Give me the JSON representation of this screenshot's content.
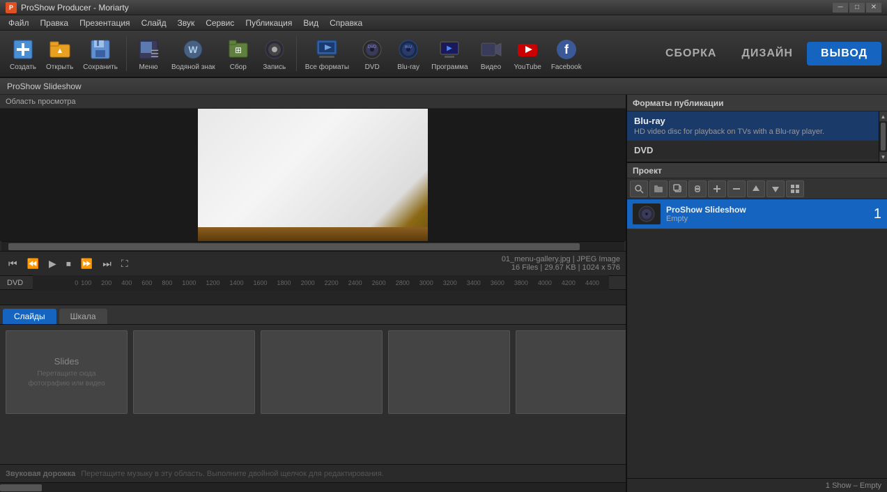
{
  "titlebar": {
    "icon_label": "P",
    "title": "ProShow Producer - Moriarty",
    "win_min": "─",
    "win_max": "□",
    "win_close": "✕"
  },
  "menubar": {
    "items": [
      "Файл",
      "Правка",
      "Презентация",
      "Слайд",
      "Звук",
      "Сервис",
      "Публикация",
      "Вид",
      "Справка"
    ]
  },
  "toolbar": {
    "buttons": [
      {
        "id": "create",
        "icon": "➕",
        "label": "Создать"
      },
      {
        "id": "open",
        "icon": "📂",
        "label": "Открыть"
      },
      {
        "id": "save",
        "icon": "💾",
        "label": "Сохранить"
      },
      {
        "id": "menu",
        "icon": "☰",
        "label": "Меню"
      },
      {
        "id": "watermark",
        "icon": "🔵",
        "label": "Водяной знак"
      },
      {
        "id": "collect",
        "icon": "📦",
        "label": "Сбор"
      },
      {
        "id": "record",
        "icon": "💿",
        "label": "Запись"
      },
      {
        "id": "allformats",
        "icon": "🎬",
        "label": "Все форматы"
      },
      {
        "id": "dvd",
        "icon": "💿",
        "label": "DVD"
      },
      {
        "id": "bluray",
        "icon": "💿",
        "label": "Blu-ray"
      },
      {
        "id": "program",
        "icon": "🖥",
        "label": "Программа"
      },
      {
        "id": "video",
        "icon": "🎥",
        "label": "Видео"
      },
      {
        "id": "youtube",
        "icon": "▶",
        "label": "YouTube"
      },
      {
        "id": "facebook",
        "icon": "👤",
        "label": "Facebook"
      }
    ],
    "mode_assembly": "СБОРКА",
    "mode_design": "ДИЗАЙН",
    "mode_output": "ВЫВОД"
  },
  "breadcrumb": {
    "text": "ProShow Slideshow"
  },
  "preview": {
    "label": "Область просмотра"
  },
  "controls": {
    "file_info_line1": "01_menu-gallery.jpg  |  JPEG Image",
    "file_info_line2": "16 Files  |  29.67 KB  |  1024 x 576"
  },
  "timeline": {
    "format_label": "DVD",
    "ruler_marks": [
      "0",
      "100",
      "200",
      "400",
      "600",
      "800",
      "1000",
      "1200",
      "1400",
      "1600",
      "1800",
      "2000",
      "2200",
      "2400",
      "2600",
      "2800",
      "3000",
      "3200",
      "3400",
      "3600",
      "3800",
      "4000",
      "4200",
      "4400"
    ],
    "footer_text": "1 Show – Empty"
  },
  "tabs": {
    "slides_label": "Слайды",
    "timeline_label": "Шкала"
  },
  "slides": {
    "placeholder_title": "Slides",
    "placeholder_hint": "Перетащите сюда\nфотографию или видео"
  },
  "audio": {
    "label": "Звуковая дорожка",
    "hint": "Перетащите музыку в эту область. Выполните двойной щелчок для редактирования."
  },
  "right_panel": {
    "pub_formats_header": "Форматы публикации",
    "formats": [
      {
        "name": "Blu-ray",
        "desc": "HD video disc for playback on TVs with a Blu-ray player.",
        "selected": true
      },
      {
        "name": "DVD",
        "desc": "",
        "selected": false
      }
    ],
    "project_header": "Проект",
    "project_toolbar_buttons": [
      "🔍",
      "📁",
      "📋",
      "🔗",
      "➕",
      "➖",
      "⬆",
      "⬇",
      "▦"
    ],
    "project_items": [
      {
        "name": "ProShow Slideshow",
        "status": "Empty",
        "num": "1",
        "selected": true
      }
    ],
    "footer_text": "1 Show – Empty"
  }
}
